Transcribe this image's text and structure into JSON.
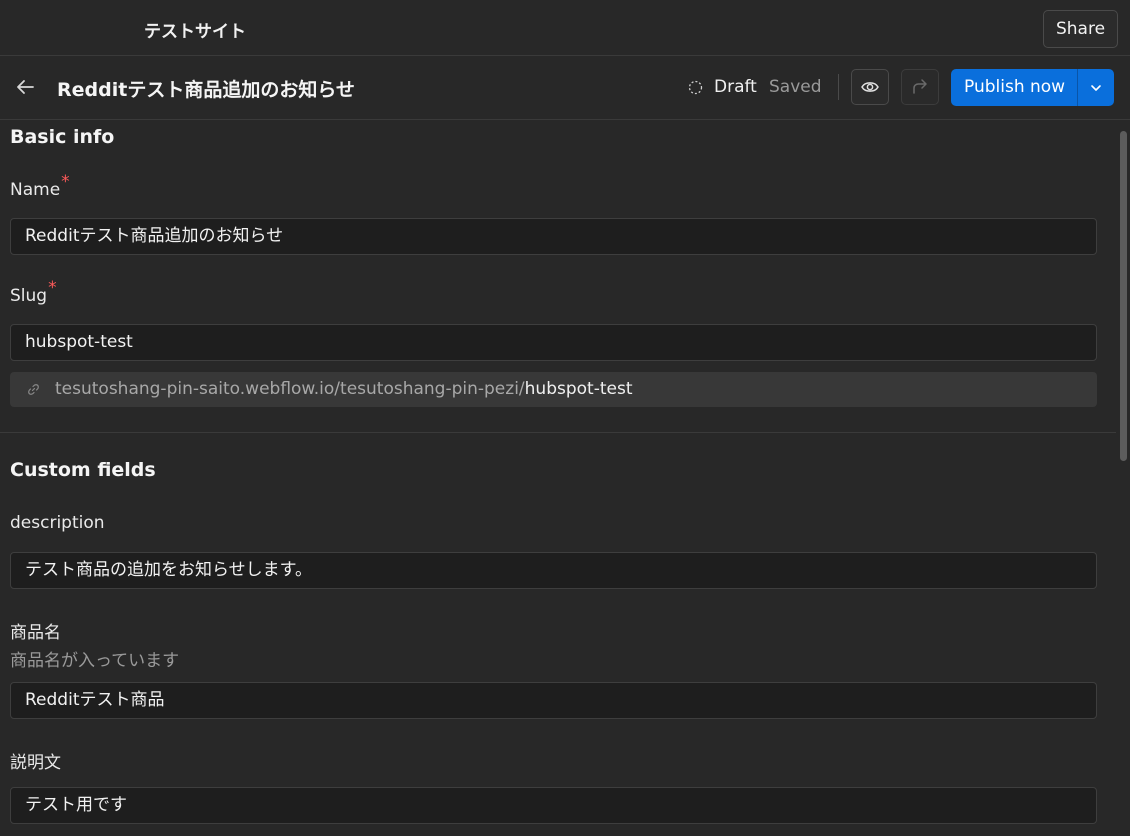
{
  "topbar": {
    "site_name": "テストサイト",
    "share_label": "Share"
  },
  "header": {
    "title": "Redditテスト商品追加のお知らせ",
    "status": "Draft",
    "saved": "Saved",
    "publish_label": "Publish now"
  },
  "basic_info": {
    "title": "Basic info",
    "name_label": "Name",
    "name_value": "Redditテスト商品追加のお知らせ",
    "slug_label": "Slug",
    "slug_value": "hubspot-test",
    "url_prefix": "tesutoshang-pin-saito.webflow.io/tesutoshang-pin-pezi/",
    "url_slug": "hubspot-test",
    "required_mark": "*"
  },
  "custom_fields": {
    "title": "Custom fields",
    "description_label": "description",
    "description_value": "テスト商品の追加をお知らせします。",
    "product_label": "商品名",
    "product_help": "商品名が入っています",
    "product_value": "Redditテスト商品",
    "explain_label": "説明文",
    "explain_value": "テスト用です"
  },
  "colors": {
    "accent": "#0a6fdc",
    "required": "#ff5a5a",
    "background": "#282828"
  }
}
